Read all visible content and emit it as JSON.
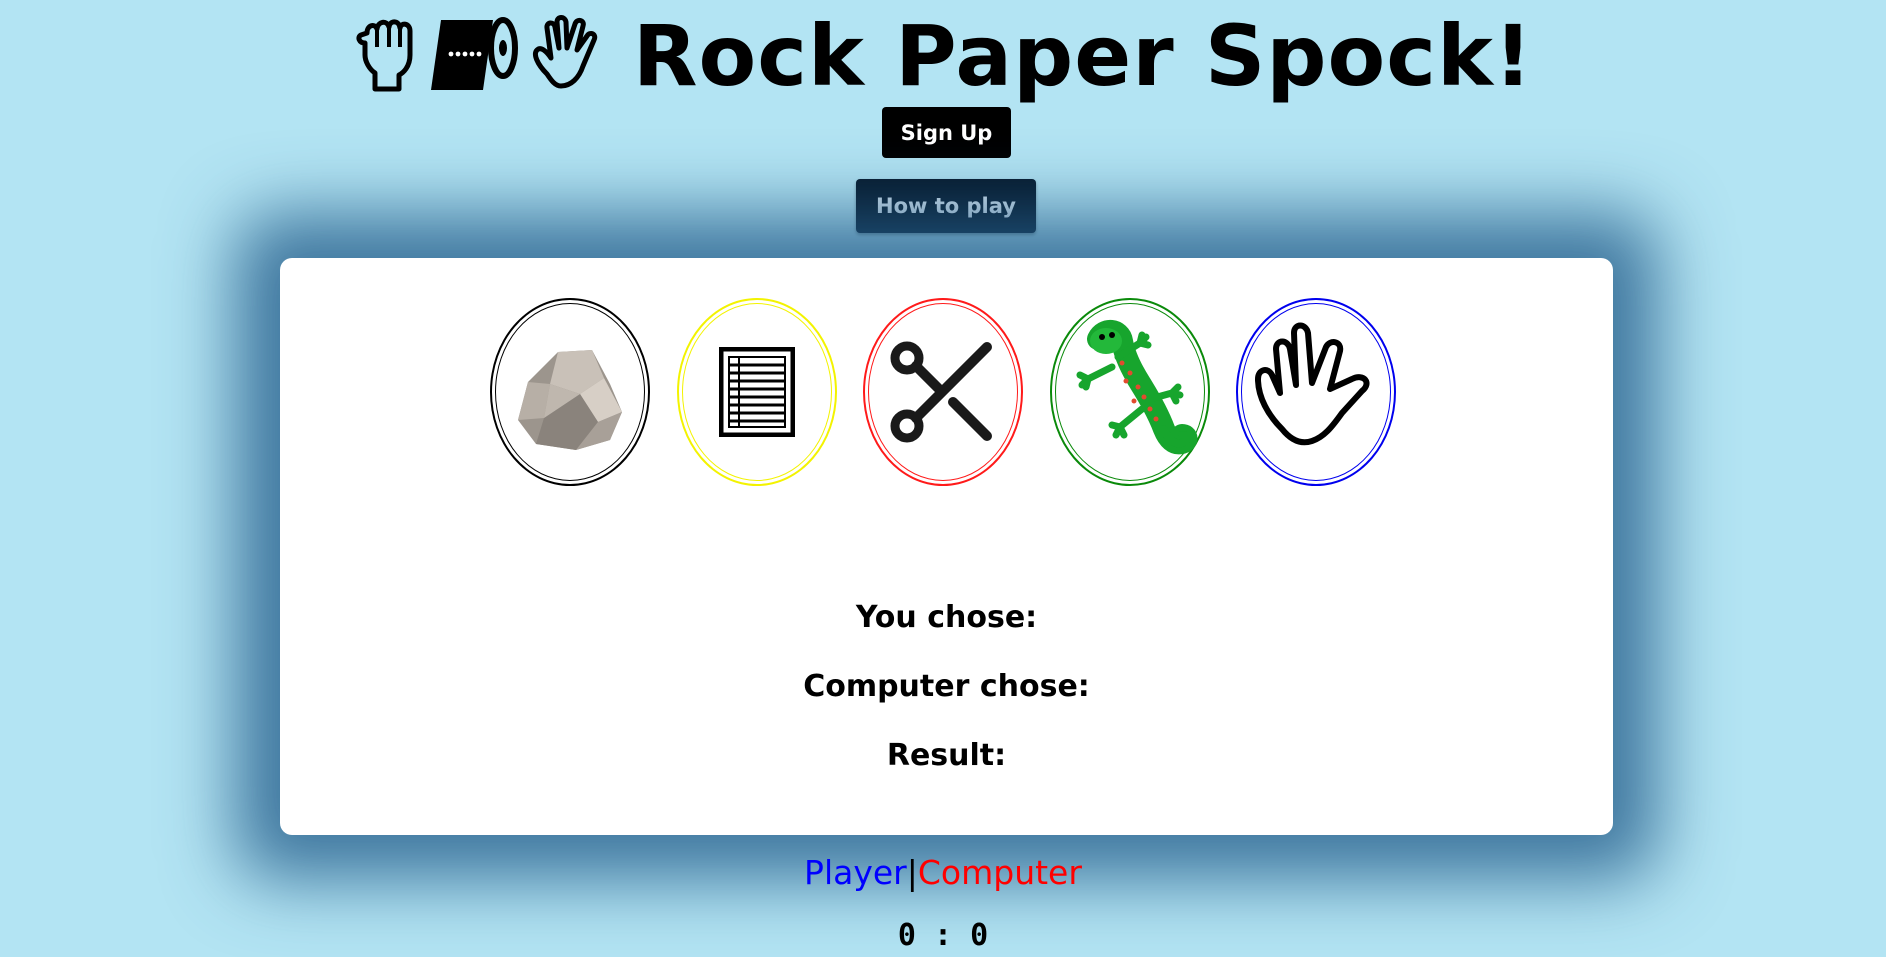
{
  "header": {
    "title": "Rock Paper Spock!",
    "icons": [
      "fist-icon",
      "paper-roll-icon",
      "spock-hand-icon"
    ]
  },
  "buttons": {
    "signup_label": "Sign Up",
    "howto_label": "How to play"
  },
  "choices": [
    {
      "name": "rock",
      "icon": "rock-icon",
      "ring_color": "#000000"
    },
    {
      "name": "paper",
      "icon": "paper-icon",
      "ring_color": "#f3f300"
    },
    {
      "name": "scissors",
      "icon": "scissors-icon",
      "ring_color": "#ff1a1a"
    },
    {
      "name": "lizard",
      "icon": "lizard-icon",
      "ring_color": "#0a8a0a"
    },
    {
      "name": "spock",
      "icon": "spock-icon",
      "ring_color": "#0000ee"
    }
  ],
  "results": {
    "you_chose": "You chose:",
    "computer_chose": "Computer chose:",
    "result": "Result:"
  },
  "score": {
    "player_label": "Player",
    "separator": "|",
    "computer_label": "Computer",
    "value": "0 : 0",
    "player_color": "#0000ff",
    "computer_color": "#ff0000"
  },
  "colors": {
    "background": "#b3e4f3",
    "card": "#ffffff",
    "card_shadow": "#265f8c"
  }
}
